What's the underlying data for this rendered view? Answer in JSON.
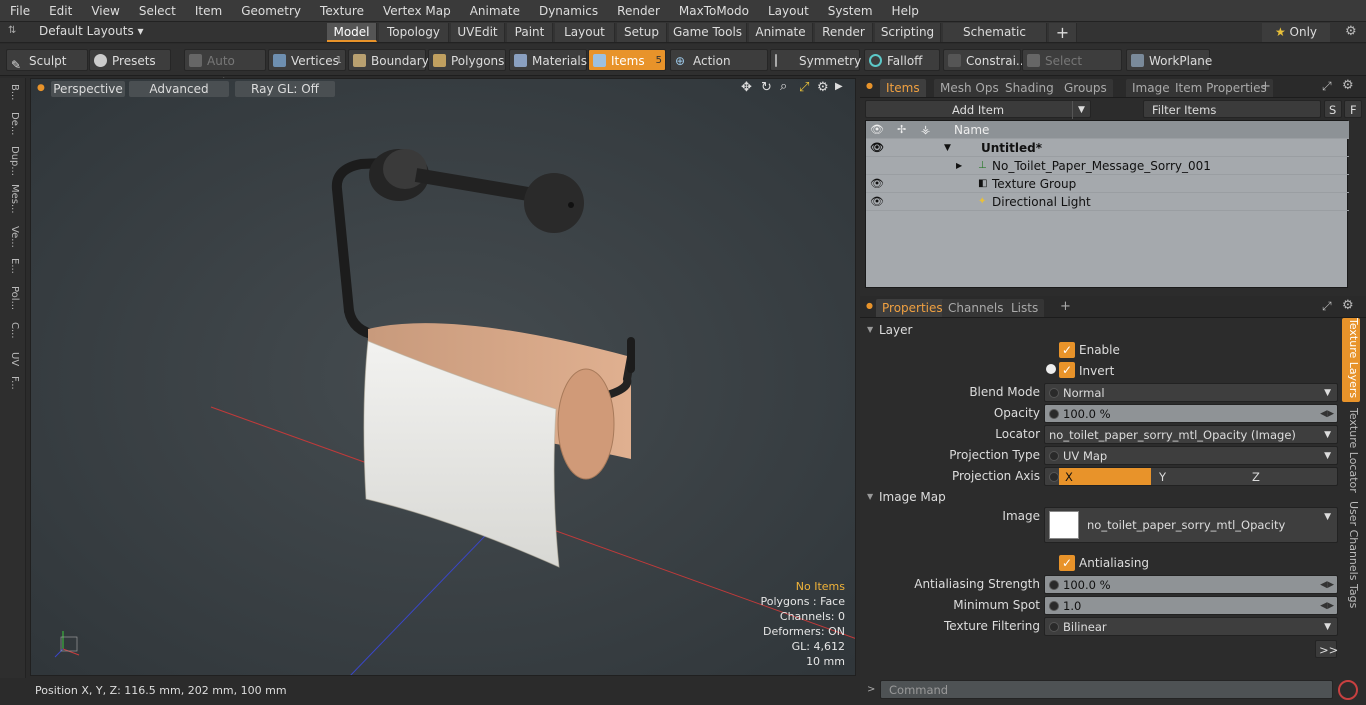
{
  "menu": [
    "File",
    "Edit",
    "View",
    "Select",
    "Item",
    "Geometry",
    "Texture",
    "Vertex Map",
    "Animate",
    "Dynamics",
    "Render",
    "MaxToModo",
    "Layout",
    "System",
    "Help"
  ],
  "layouts": {
    "label": "Default Layouts",
    "only": "Only",
    "tabs": [
      "Model",
      "Topology",
      "UVEdit",
      "Paint",
      "Layout",
      "Setup",
      "Game Tools",
      "Animate",
      "Render",
      "Scripting",
      "Schematic Fusion"
    ],
    "plus": "+"
  },
  "toolbar": {
    "sculpt": "Sculpt",
    "presets": "Presets",
    "auto_select": "Auto Select",
    "vertices": "Vertices",
    "vertices_count": "1",
    "boundary": "Boundary",
    "polygons": "Polygons",
    "materials": "Materials",
    "items": "Items",
    "items_count": "5",
    "action_center": "Action Center",
    "symmetry": "Symmetry",
    "falloff": "Falloff",
    "constraints": "Constrai...",
    "select_through": "Select Through",
    "workplane": "WorkPlane"
  },
  "left_tabs": [
    "B...",
    "De...",
    "Dup...",
    "Mes...",
    "Ve...",
    "E...",
    "Pol...",
    "C...",
    "UV",
    "F..."
  ],
  "viewport": {
    "perspective": "Perspective",
    "advanced": "Advanced",
    "raygl": "Ray GL: Off",
    "info": [
      "No Items",
      "Polygons : Face",
      "Channels: 0",
      "Deformers: ON",
      "GL: 4,612",
      "10 mm"
    ]
  },
  "status": {
    "position": "Position X, Y, Z:   116.5 mm, 202 mm, 100 mm"
  },
  "items_panel": {
    "tabs": [
      "Items",
      "Mesh Ops",
      "Shading",
      "Groups",
      "Images",
      "Item Properties"
    ],
    "add_item": "Add Item",
    "filter": "Filter Items",
    "s": "S",
    "f": "F",
    "col_name": "Name",
    "rows": [
      {
        "name": "Untitled*"
      },
      {
        "name": "No_Toilet_Paper_Message_Sorry_001"
      },
      {
        "name": "Texture Group"
      },
      {
        "name": "Directional Light"
      }
    ]
  },
  "props_panel": {
    "tabs": [
      "Properties",
      "Channels",
      "Lists"
    ],
    "layer": "Layer",
    "enable": "Enable",
    "invert": "Invert",
    "blend_mode_label": "Blend Mode",
    "blend_mode": "Normal",
    "opacity_label": "Opacity",
    "opacity": "100.0 %",
    "locator_label": "Locator",
    "locator": "no_toilet_paper_sorry_mtl_Opacity (Image) (Texture)",
    "proj_type_label": "Projection Type",
    "proj_type": "UV Map",
    "proj_axis_label": "Projection Axis",
    "axis_x": "X",
    "axis_y": "Y",
    "axis_z": "Z",
    "image_map": "Image Map",
    "image_label": "Image",
    "image": "no_toilet_paper_sorry_mtl_Opacity",
    "antialiasing": "Antialiasing",
    "aa_strength_label": "Antialiasing Strength",
    "aa_strength": "100.0 %",
    "min_spot_label": "Minimum Spot",
    "min_spot": "1.0",
    "tex_filter_label": "Texture Filtering",
    "tex_filter": "Bilinear",
    "more": ">>",
    "side_tabs": [
      "Texture Layers",
      "Texture Locator",
      "User Channels",
      "Tags"
    ]
  },
  "command": {
    "placeholder": "Command"
  },
  "colors": {
    "accent": "#e8932a",
    "item_list_bg": "#a5a9ad"
  }
}
